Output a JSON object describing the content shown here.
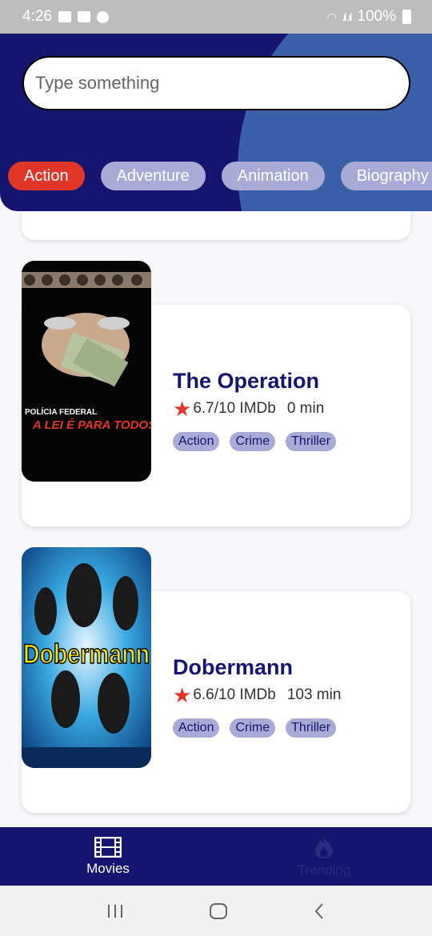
{
  "status_bar": {
    "time": "4:26",
    "battery": "100%"
  },
  "search": {
    "placeholder": "Type something"
  },
  "genres": [
    "Action",
    "Adventure",
    "Animation",
    "Biography"
  ],
  "movies": [
    {
      "title": "The Operation",
      "rating": "6.7/10 IMDb",
      "runtime": "0 min",
      "tags": [
        "Action",
        "Crime",
        "Thriller"
      ],
      "poster_text_1": "POLÍCIA FEDERAL",
      "poster_text_2": "A LEI É PARA TODOS"
    },
    {
      "title": "Dobermann",
      "rating": "6.6/10 IMDb",
      "runtime": "103 min",
      "tags": [
        "Action",
        "Crime",
        "Thriller"
      ],
      "poster_text_1": "Dobermann"
    }
  ],
  "bottom_nav": {
    "movies": "Movies",
    "trending": "Trending"
  },
  "colors": {
    "primary": "#15156f",
    "accent": "#e0362a",
    "chip": "#a9abd6",
    "circle": "#3b5fa8"
  }
}
